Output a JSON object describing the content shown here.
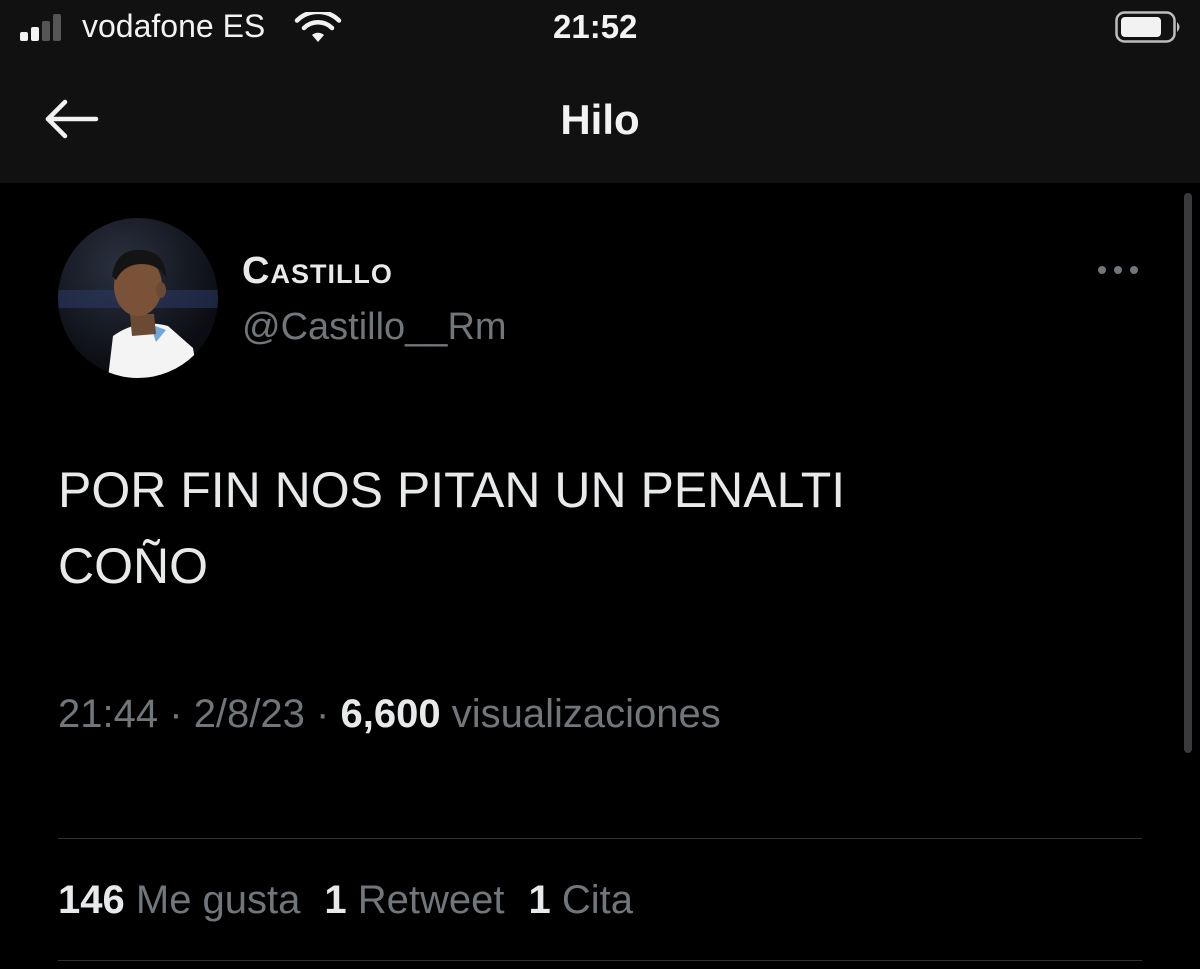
{
  "status_bar": {
    "carrier": "vodafone ES",
    "time": "21:52",
    "icons": [
      "signal-icon",
      "wifi-icon",
      "battery-icon"
    ]
  },
  "header": {
    "title": "Hilo",
    "back_icon": "arrow-left-icon"
  },
  "tweet": {
    "display_name": "Castillo",
    "handle": "@Castillo__Rm",
    "more_icon": "more-horizontal-icon",
    "text": "POR FIN NOS PITAN UN PENALTI\nCOÑO",
    "time": "21:44",
    "date": "2/8/23",
    "separator": "·",
    "views_count": "6,600",
    "views_label": "visualizaciones",
    "stats": {
      "likes_count": "146",
      "likes_label": "Me gusta",
      "retweets_count": "1",
      "retweets_label": "Retweet",
      "quotes_count": "1",
      "quotes_label": "Cita"
    }
  },
  "colors": {
    "background": "#000000",
    "header_background": "#111111",
    "primary_text": "#e7e9ea",
    "secondary_text": "#71767b",
    "divider": "#2f3336"
  }
}
